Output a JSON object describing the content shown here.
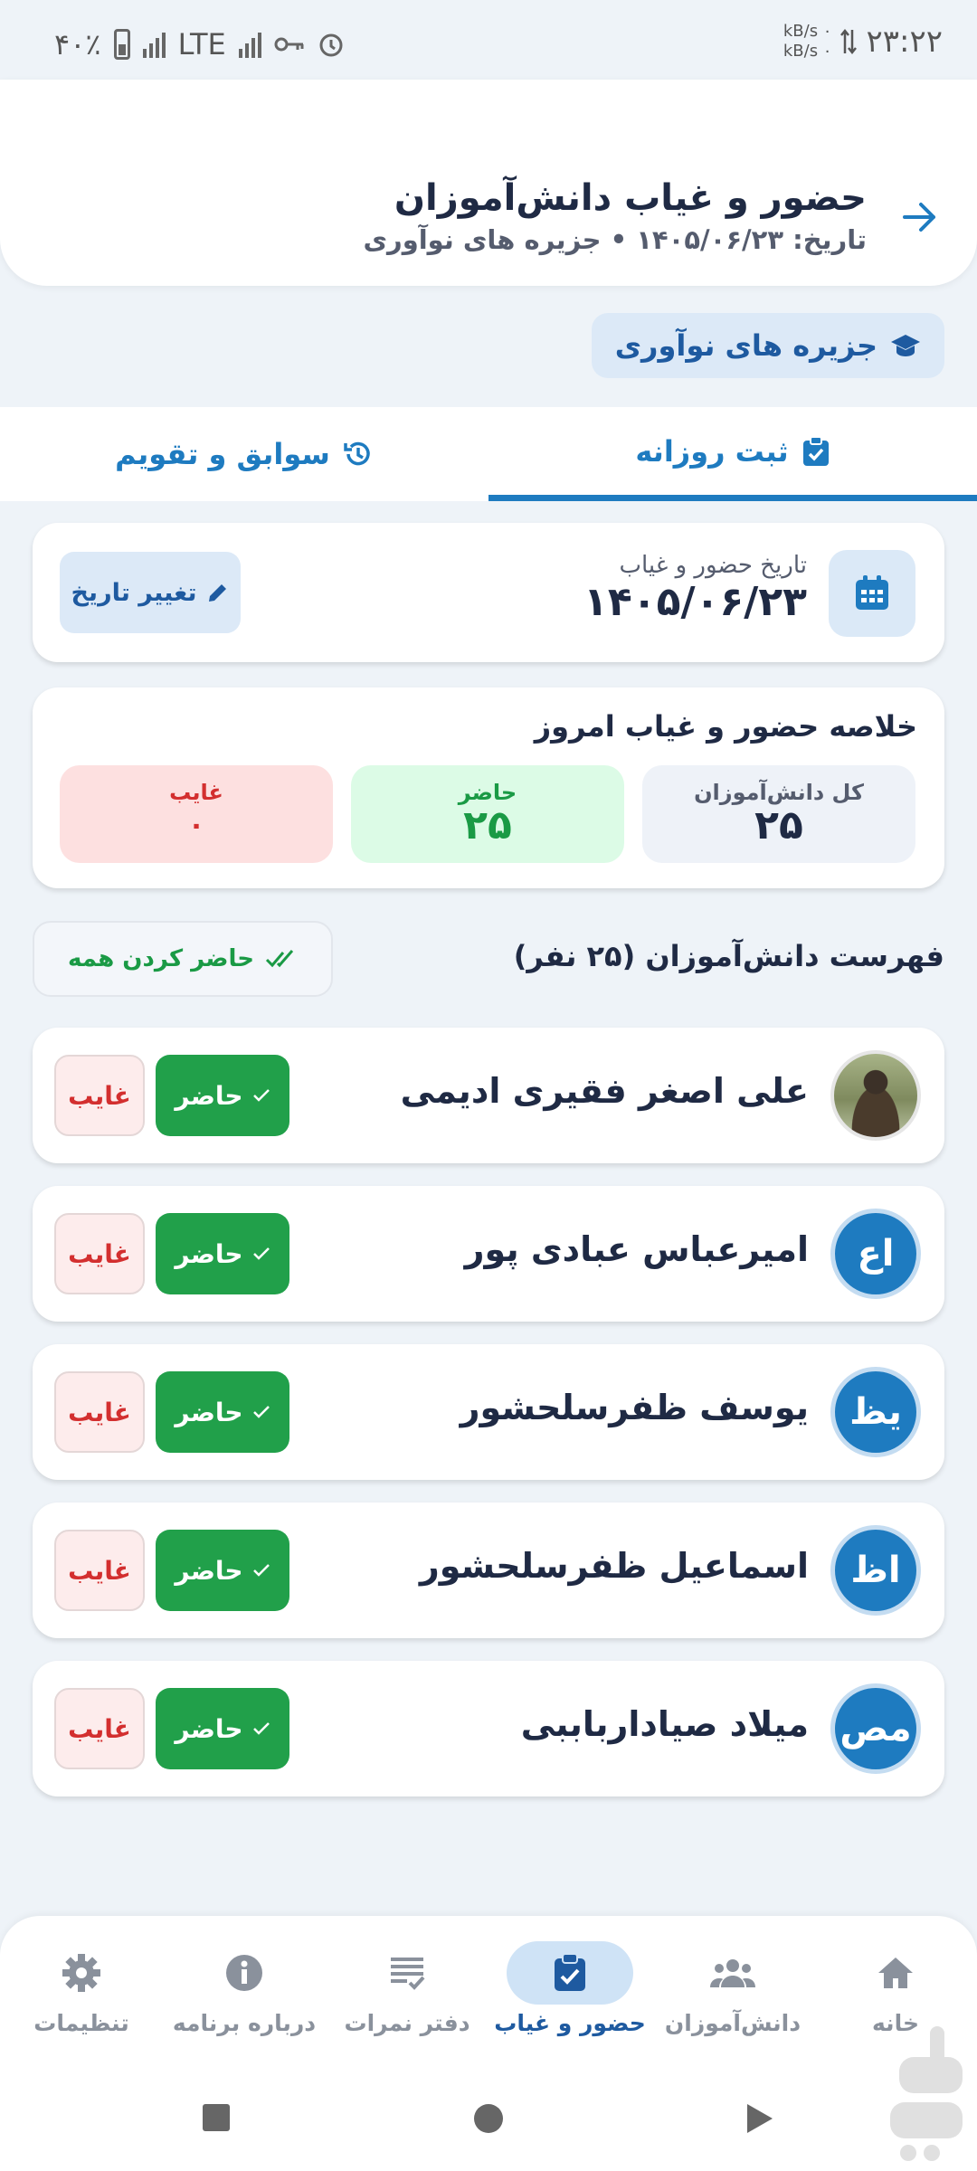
{
  "status_bar": {
    "time": "۲۳:۲۲",
    "speed_up": "kB/s ۰",
    "speed_down": "kB/s ۰",
    "battery": "۴۰٪",
    "network": "LTE"
  },
  "header": {
    "title": "حضور و غیاب دانش‌آموزان",
    "subtitle": "تاریخ: ۱۴۰۵/۰۶/۲۳ • جزیره های نوآوری"
  },
  "school_chip": "جزیره های نوآوری",
  "tabs": [
    {
      "label": "ثبت روزانه",
      "active": true
    },
    {
      "label": "سوابق و تقویم",
      "active": false
    }
  ],
  "date_card": {
    "label": "تاریخ حضور و غیاب",
    "value": "۱۴۰۵/۰۶/۲۳",
    "change_button": "تغییر تاریخ"
  },
  "summary": {
    "title": "خلاصه حضور و غیاب امروز",
    "total_label": "کل دانش‌آموزان",
    "total_value": "۲۵",
    "present_label": "حاضر",
    "present_value": "۲۵",
    "absent_label": "غایب",
    "absent_value": "۰"
  },
  "list": {
    "title": "فهرست دانش‌آموزان (۲۵ نفر)",
    "mark_all": "حاضر کردن همه"
  },
  "students": [
    {
      "name": "علی اصغر فقیری ادیمی",
      "initials": "",
      "photo": true
    },
    {
      "name": "امیرعباس عبادی پور",
      "initials": "اع",
      "photo": false
    },
    {
      "name": "یوسف ظفرسلحشور",
      "initials": "یظ",
      "photo": false
    },
    {
      "name": "اسماعیل ظفرسلحشور",
      "initials": "اظ",
      "photo": false
    },
    {
      "name": "میلاد صیادارباببی",
      "initials": "مص",
      "photo": false
    }
  ],
  "buttons": {
    "present": "حاضر",
    "absent": "غایب"
  },
  "bottom_nav": [
    {
      "label": "خانه",
      "icon": "home-icon"
    },
    {
      "label": "دانش‌آموزان",
      "icon": "group-icon"
    },
    {
      "label": "حضور و غیاب",
      "icon": "clipboard-check-icon",
      "active": true
    },
    {
      "label": "دفتر نمرات",
      "icon": "list-check-icon"
    },
    {
      "label": "درباره برنامه",
      "icon": "info-icon"
    },
    {
      "label": "تنظیمات",
      "icon": "gear-icon"
    }
  ],
  "colors": {
    "primary": "#1e7bc0",
    "present": "#21a04a",
    "absent": "#d32f2f"
  }
}
